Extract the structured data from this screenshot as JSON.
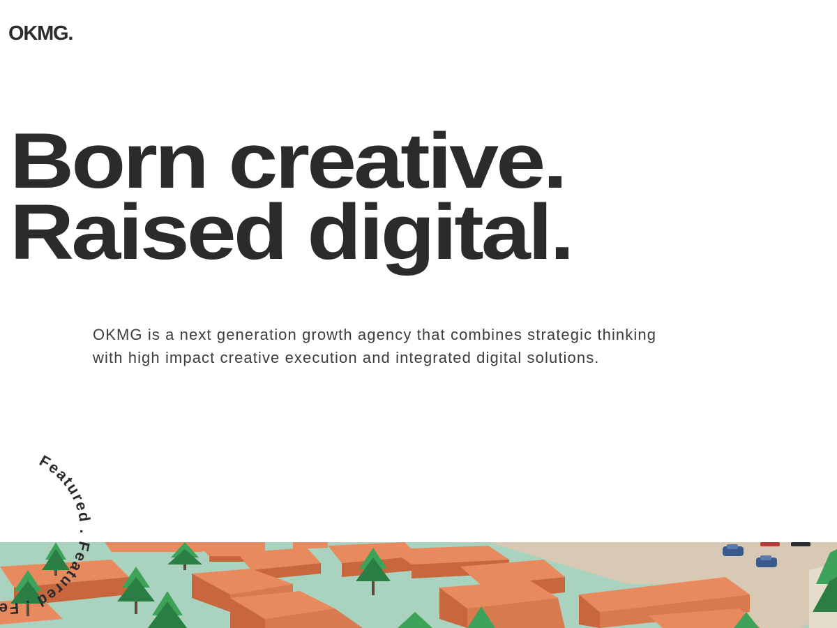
{
  "header": {
    "logo_text": "OKMG."
  },
  "hero": {
    "line1": "Born creative.",
    "line2": "Raised digital."
  },
  "intro": {
    "text": "OKMG is a next generation growth agency that combines strategic thinking with high impact creative execution and integrated digital solutions."
  },
  "featured_badge": {
    "text": "Featured . Featured . Featured . "
  },
  "colors": {
    "text": "#2b2b2d",
    "ground": "#a9d3bf",
    "roof": "#e98a5e",
    "roof_shade": "#c8673e",
    "tree": "#3da35a",
    "tree_dark": "#2a7e43",
    "road": "#d7c9b4"
  }
}
